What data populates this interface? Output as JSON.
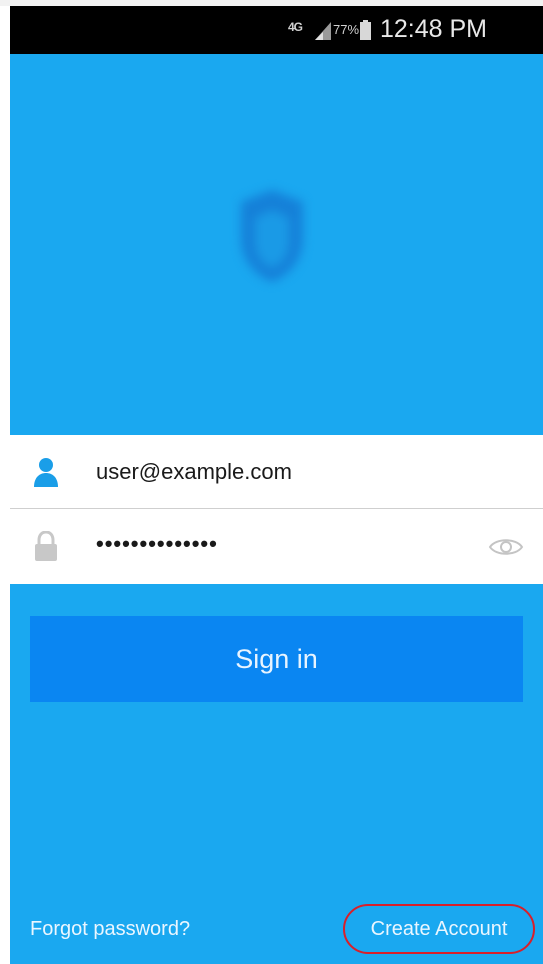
{
  "status_bar": {
    "network": "4G",
    "battery_percent": "77%",
    "time": "12:48 PM"
  },
  "login_form": {
    "username_value": "user@example.com",
    "password_value": "••••••••••••••"
  },
  "actions": {
    "sign_in_label": "Sign in",
    "forgot_password_label": "Forgot password?",
    "create_account_label": "Create Account"
  },
  "colors": {
    "background": "#1aa8f0",
    "button": "#0a86f2",
    "highlight_circle": "#d91f2a",
    "user_icon": "#1a9ee8"
  },
  "icons": {
    "user_field": "user-icon",
    "password_field": "lock-icon",
    "show_password": "eye-icon",
    "app_logo": "shield-logo-icon"
  }
}
